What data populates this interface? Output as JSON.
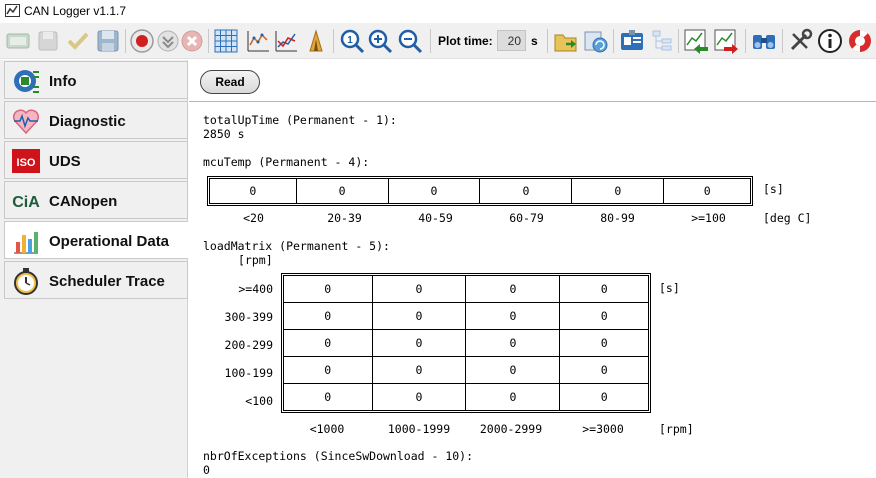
{
  "window": {
    "title": "CAN Logger v1.1.7"
  },
  "toolbar": {
    "plot_time_label": "Plot time:",
    "plot_time_value": "20",
    "plot_time_unit": "s"
  },
  "sidebar": {
    "items": [
      {
        "label": "Info",
        "icon": "gear-chip-icon"
      },
      {
        "label": "Diagnostic",
        "icon": "heart-pulse-icon"
      },
      {
        "label": "UDS",
        "icon": "iso-icon"
      },
      {
        "label": "CANopen",
        "icon": "cia-icon"
      },
      {
        "label": "Operational Data",
        "icon": "bar-chart-icon",
        "selected": true
      },
      {
        "label": "Scheduler Trace",
        "icon": "stopwatch-icon"
      }
    ]
  },
  "content": {
    "read_button": "Read",
    "uptime": {
      "title": "totalUpTime (Permanent - 1):",
      "value": "2850 s"
    },
    "mcu_temp": {
      "title": "mcuTemp (Permanent - 4):",
      "values": [
        "0",
        "0",
        "0",
        "0",
        "0",
        "0"
      ],
      "unit": "[s]",
      "bins": [
        "<20",
        "20-39",
        "40-59",
        "60-79",
        "80-99",
        ">=100"
      ],
      "bin_unit": "[deg C]"
    },
    "load_matrix": {
      "title": "loadMatrix (Permanent - 5):",
      "row_unit": "[rpm]",
      "cell_unit": "[s]",
      "rows": [
        {
          "label": ">=400",
          "values": [
            "0",
            "0",
            "0",
            "0"
          ]
        },
        {
          "label": "300-399",
          "values": [
            "0",
            "0",
            "0",
            "0"
          ]
        },
        {
          "label": "200-299",
          "values": [
            "0",
            "0",
            "0",
            "0"
          ]
        },
        {
          "label": "100-199",
          "values": [
            "0",
            "0",
            "0",
            "0"
          ]
        },
        {
          "label": "<100",
          "values": [
            "0",
            "0",
            "0",
            "0"
          ]
        }
      ],
      "cols": [
        "<1000",
        "1000-1999",
        "2000-2999",
        ">=3000"
      ],
      "col_unit": "[rpm]"
    },
    "exceptions": {
      "title": "nbrOfExceptions (SinceSwDownload - 10):",
      "value": "0"
    }
  },
  "colors": {
    "accent_blue": "#1f5fa8",
    "selected_tab": "#ffffff",
    "panel_bg": "#f0f0f0"
  }
}
